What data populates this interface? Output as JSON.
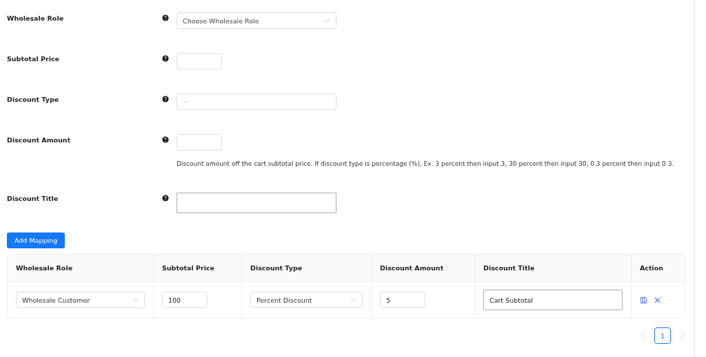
{
  "form": [
    {
      "label": "Wholesale Role",
      "kind": "select",
      "placeholder": "Choose Wholesale Role"
    },
    {
      "label": "Subtotal Price",
      "kind": "number"
    },
    {
      "label": "Discount Type",
      "kind": "select"
    },
    {
      "label": "Discount Amount",
      "kind": "number",
      "description": "Discount amount off the cart subtotal price. If discount type is percentage (%), Ex. 3 percent then input 3, 30 percent then input 30, 0.3 percent then input 0.3."
    },
    {
      "label": "Discount Title",
      "kind": "text"
    }
  ],
  "add_button": "Add Mapping",
  "table": {
    "columns": [
      "Wholesale Role",
      "Subtotal Price",
      "Discount Type",
      "Discount Amount",
      "Discount Title",
      "Action"
    ],
    "rows": [
      [
        {
          "kind": "select",
          "value": "Wholesale Customer"
        },
        {
          "kind": "number",
          "value": "100"
        },
        {
          "kind": "select",
          "value": "Percent Discount"
        },
        {
          "kind": "number",
          "value": "5"
        },
        {
          "kind": "text",
          "value": "Cart Subtotal"
        },
        {
          "kind": "actions"
        }
      ]
    ]
  },
  "pagination": {
    "prev_disabled": true,
    "pages": [
      {
        "label": "1",
        "selected": true
      }
    ],
    "next_disabled": true
  }
}
